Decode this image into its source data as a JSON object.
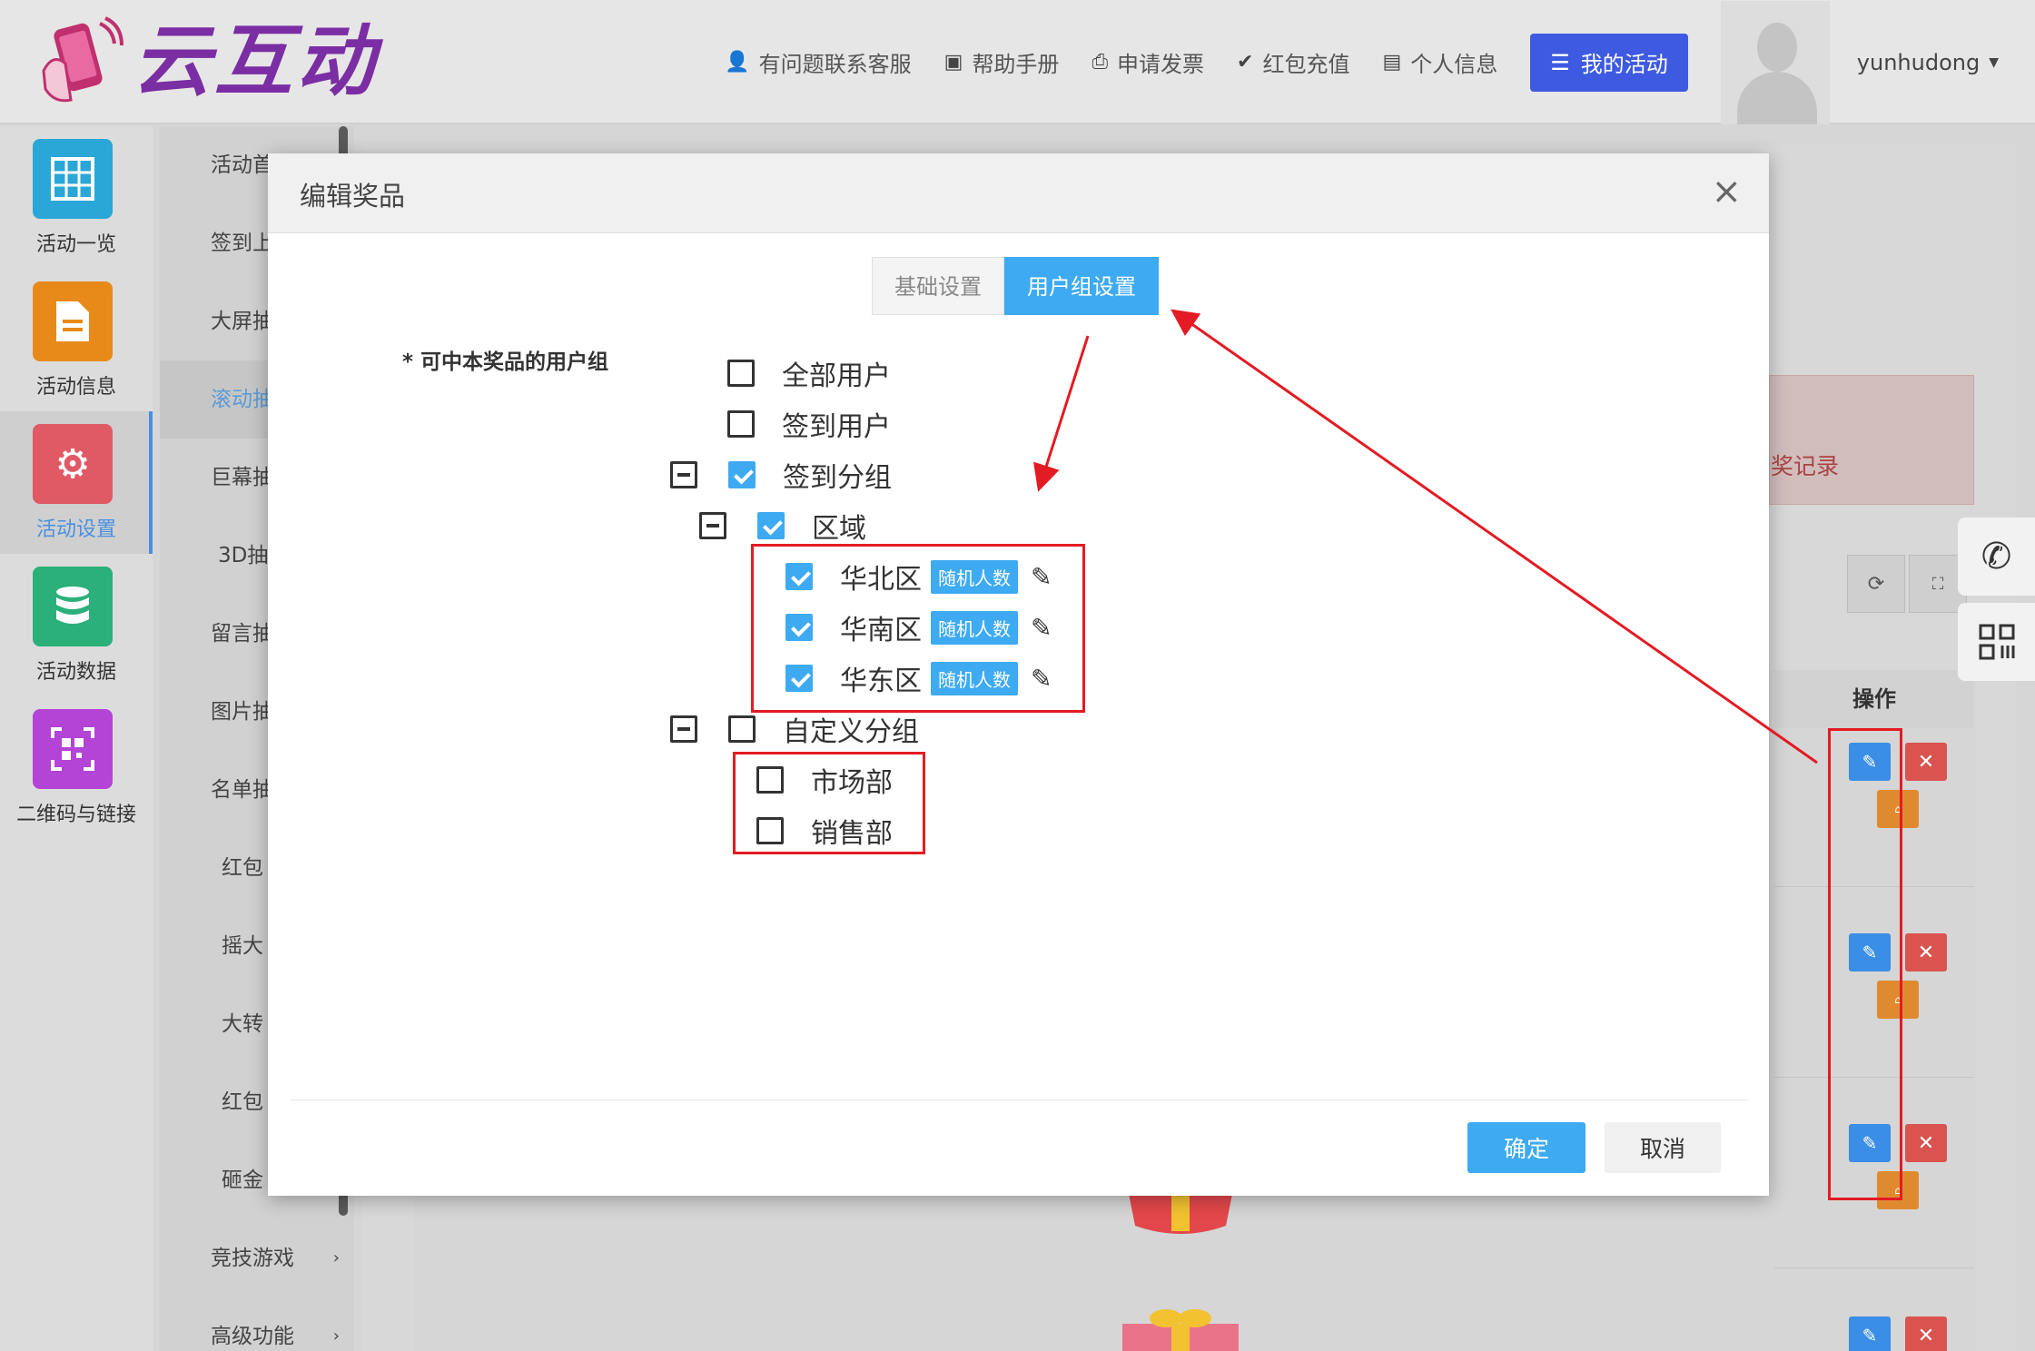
{
  "brand": {
    "logo_text": "云互动"
  },
  "topnav": {
    "items": [
      {
        "label": "有问题联系客服",
        "icon": "user-plus-icon"
      },
      {
        "label": "帮助手册",
        "icon": "book-icon"
      },
      {
        "label": "申请发票",
        "icon": "printer-icon"
      },
      {
        "label": "红包充值",
        "icon": "shield-check-icon"
      },
      {
        "label": "个人信息",
        "icon": "file-icon"
      }
    ],
    "my_activity": "我的活动",
    "username": "yunhudong"
  },
  "iconbar": {
    "items": [
      {
        "label": "活动一览",
        "color": "#2aa7d6",
        "icon": "grid-icon"
      },
      {
        "label": "活动信息",
        "color": "#e88a1a",
        "icon": "document-icon"
      },
      {
        "label": "活动设置",
        "color": "#e05a66",
        "icon": "gear-icon",
        "active": true
      },
      {
        "label": "活动数据",
        "color": "#2bb07a",
        "icon": "database-icon"
      },
      {
        "label": "二维码与链接",
        "color": "#b344d6",
        "icon": "qrcode-icon"
      }
    ]
  },
  "submenu": {
    "items": [
      {
        "label": "活动首"
      },
      {
        "label": "签到上"
      },
      {
        "label": "大屏抽"
      },
      {
        "label": "滚动抽",
        "active": true
      },
      {
        "label": "巨幕抽"
      },
      {
        "label": "3D抽"
      },
      {
        "label": "留言抽"
      },
      {
        "label": "图片抽"
      },
      {
        "label": "名单抽"
      },
      {
        "label": "红包"
      },
      {
        "label": "摇大"
      },
      {
        "label": "大转"
      },
      {
        "label": "红包"
      },
      {
        "label": "砸金"
      },
      {
        "label": "竞技游戏"
      },
      {
        "label": "高级功能"
      }
    ]
  },
  "background": {
    "prize_record_label": "奖记录",
    "ops_header": "操作"
  },
  "modal": {
    "title": "编辑奖品",
    "tabs": [
      {
        "label": "基础设置"
      },
      {
        "label": "用户组设置"
      }
    ],
    "group_label": "* 可中本奖品的用户组",
    "tree": {
      "all_users": "全部用户",
      "checked_in_users": "签到用户",
      "checkin_groups": "签到分组",
      "region": "区域",
      "regions": [
        {
          "label": "华北区",
          "tag": "随机人数"
        },
        {
          "label": "华南区",
          "tag": "随机人数"
        },
        {
          "label": "华东区",
          "tag": "随机人数"
        }
      ],
      "custom_groups": "自定义分组",
      "departments": [
        {
          "label": "市场部"
        },
        {
          "label": "销售部"
        }
      ]
    },
    "confirm": "确定",
    "cancel": "取消"
  },
  "colors": {
    "accent": "#3eaaf2",
    "nav_button": "#3d5ae0",
    "annotation": "#e31b23"
  }
}
